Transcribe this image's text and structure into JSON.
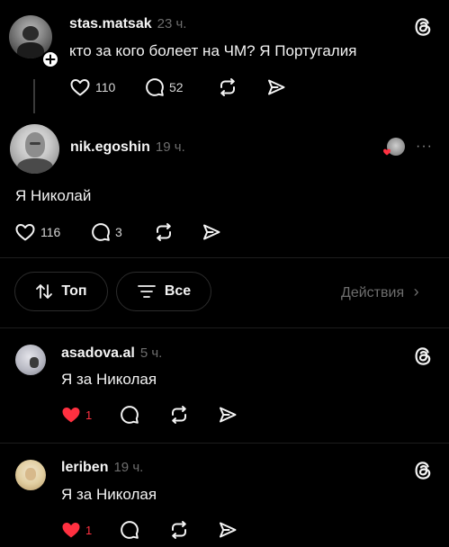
{
  "colors": {
    "background": "#000000",
    "text": "#f3f3f3",
    "muted": "#6e6e6e",
    "like_red": "#ff3040"
  },
  "post": {
    "username": "stas.matsak",
    "time": "23 ч.",
    "text": "кто за кого болеет на ЧМ? Я Португалия",
    "likes": "110",
    "comments": "52",
    "icons": [
      "threads-icon",
      "follow-plus-icon",
      "heart-icon",
      "comment-icon",
      "repost-icon",
      "share-icon"
    ]
  },
  "reply_main": {
    "username": "nik.egoshin",
    "time": "19 ч.",
    "text": "Я Николай",
    "likes": "116",
    "comments": "3",
    "more": "···"
  },
  "filters": {
    "top_label": "Топ",
    "all_label": "Все",
    "actions_label": "Действия",
    "actions_chevron": "›"
  },
  "comments": [
    {
      "username": "asadova.al",
      "time": "5 ч.",
      "text": "Я за Николая",
      "likes": "1"
    },
    {
      "username": "leriben",
      "time": "19 ч.",
      "text": "Я за Николая",
      "likes": "1"
    }
  ]
}
